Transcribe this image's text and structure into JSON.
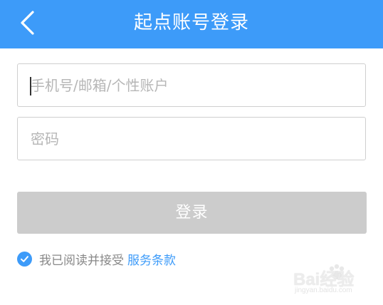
{
  "header": {
    "title": "起点账号登录",
    "background_color": "#3d9bf9",
    "back_icon": "chevron-left-icon"
  },
  "form": {
    "account": {
      "value": "",
      "placeholder": "手机号/邮箱/个性账户"
    },
    "password": {
      "value": "",
      "placeholder": "密码"
    },
    "login_label": "登录",
    "login_button_color": "#cccccc"
  },
  "agreement": {
    "checked": true,
    "text": "我已阅读并接受",
    "link_text": "服务条款",
    "accent_color": "#3d9bf9"
  },
  "watermark": {
    "logo_text": "Bai经验",
    "url_text": "jingyan.baidu.com"
  }
}
